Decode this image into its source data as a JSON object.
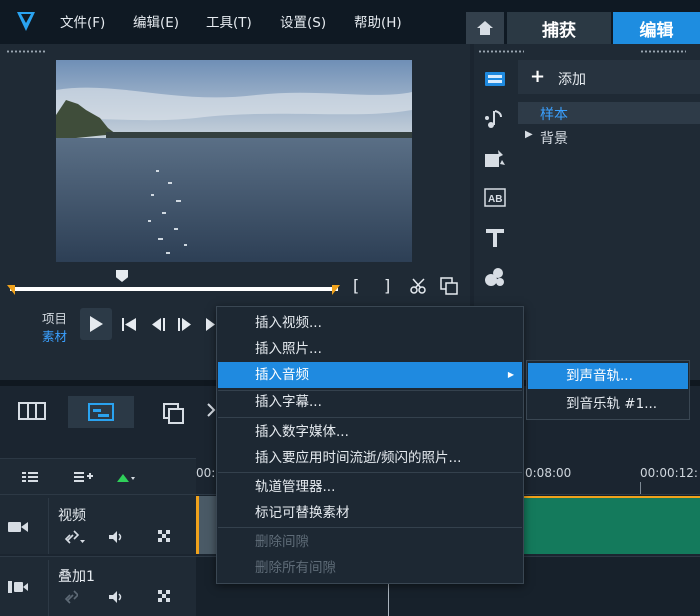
{
  "menubar": {
    "items": [
      "文件(F)",
      "编辑(E)",
      "工具(T)",
      "设置(S)",
      "帮助(H)"
    ]
  },
  "tabs": {
    "capture": "捕获",
    "edit": "编辑"
  },
  "player": {
    "label_project": "项目",
    "label_clip": "素材",
    "mark_in": "[",
    "mark_out": "]"
  },
  "library": {
    "add_label": "添加",
    "sample": "样本",
    "background": "背景"
  },
  "timeline": {
    "ruler": [
      "00:",
      "0:08:00",
      "00:00:12:"
    ],
    "tracks": [
      {
        "name": "视频"
      },
      {
        "name": "叠加1"
      }
    ]
  },
  "context_menu": {
    "items": [
      {
        "label": "插入视频...",
        "state": "normal"
      },
      {
        "label": "插入照片...",
        "state": "normal"
      },
      {
        "label": "插入音频",
        "state": "highlight",
        "submenu": true
      },
      {
        "label": "插入字幕...",
        "state": "normal"
      },
      {
        "label": "插入数字媒体...",
        "state": "normal"
      },
      {
        "label": "插入要应用时间流逝/频闪的照片...",
        "state": "normal"
      },
      {
        "label": "轨道管理器...",
        "state": "normal"
      },
      {
        "label": "标记可替换素材",
        "state": "normal"
      },
      {
        "label": "删除间隙",
        "state": "disabled"
      },
      {
        "label": "删除所有间隙",
        "state": "disabled"
      }
    ],
    "submenu": [
      {
        "label": "到声音轨...",
        "state": "highlight"
      },
      {
        "label": "到音乐轨 #1...",
        "state": "normal"
      }
    ]
  },
  "colors": {
    "accent": "#1f8ae0",
    "clip": "#147a5c",
    "marker": "#f0a21c"
  }
}
